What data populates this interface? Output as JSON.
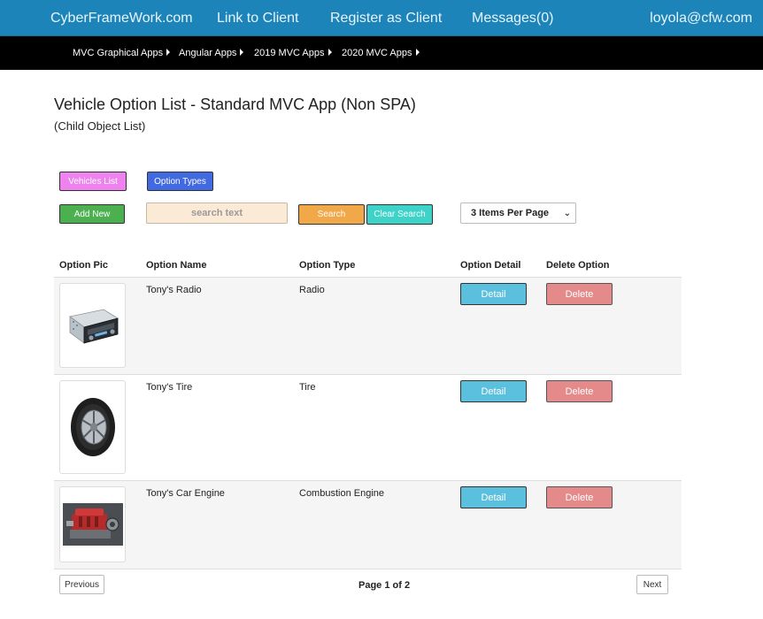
{
  "topnav": {
    "brand": "CyberFrameWork.com",
    "links": [
      "Link to Client",
      "Register as Client",
      "Messages(0)"
    ],
    "user": "loyola@cfw.com",
    "bg_color": "#1c84b8"
  },
  "subnav": {
    "items": [
      "MVC Graphical Apps",
      "Angular Apps",
      "2019 MVC Apps",
      "2020 MVC Apps"
    ],
    "caret_icon": "caret-right-icon"
  },
  "page": {
    "title": "Vehicle Option List - Standard MVC App (Non SPA)",
    "subtitle": "(Child Object List)"
  },
  "toolbar": {
    "vehicles_label": "Vehicles List",
    "option_types_label": "Option Types",
    "add_new_label": "Add New",
    "search_placeholder": "search text",
    "search_value": "",
    "search_label": "Search",
    "clear_label": "Clear Search",
    "per_page_selected": "3 Items Per Page",
    "colors": {
      "vehicles": "#ee82ee",
      "option_types": "#4169e1",
      "add_new": "#4caf50",
      "search": "#f0a848",
      "clear": "#3dd3c8"
    }
  },
  "table": {
    "headers": [
      "Option Pic",
      "Option Name",
      "Option Type",
      "Option Detail",
      "Delete Option"
    ],
    "rows": [
      {
        "name": "Tony's Radio",
        "type": "Radio",
        "image": "car-radio-image",
        "detail_label": "Detail",
        "delete_label": "Delete"
      },
      {
        "name": "Tony's Tire",
        "type": "Tire",
        "image": "tire-image",
        "detail_label": "Detail",
        "delete_label": "Delete"
      },
      {
        "name": "Tony's Car Engine",
        "type": "Combustion Engine",
        "image": "car-engine-image",
        "detail_label": "Detail",
        "delete_label": "Delete"
      }
    ]
  },
  "pager": {
    "prev_label": "Previous",
    "page_info": "Page 1 of 2",
    "next_label": "Next"
  }
}
